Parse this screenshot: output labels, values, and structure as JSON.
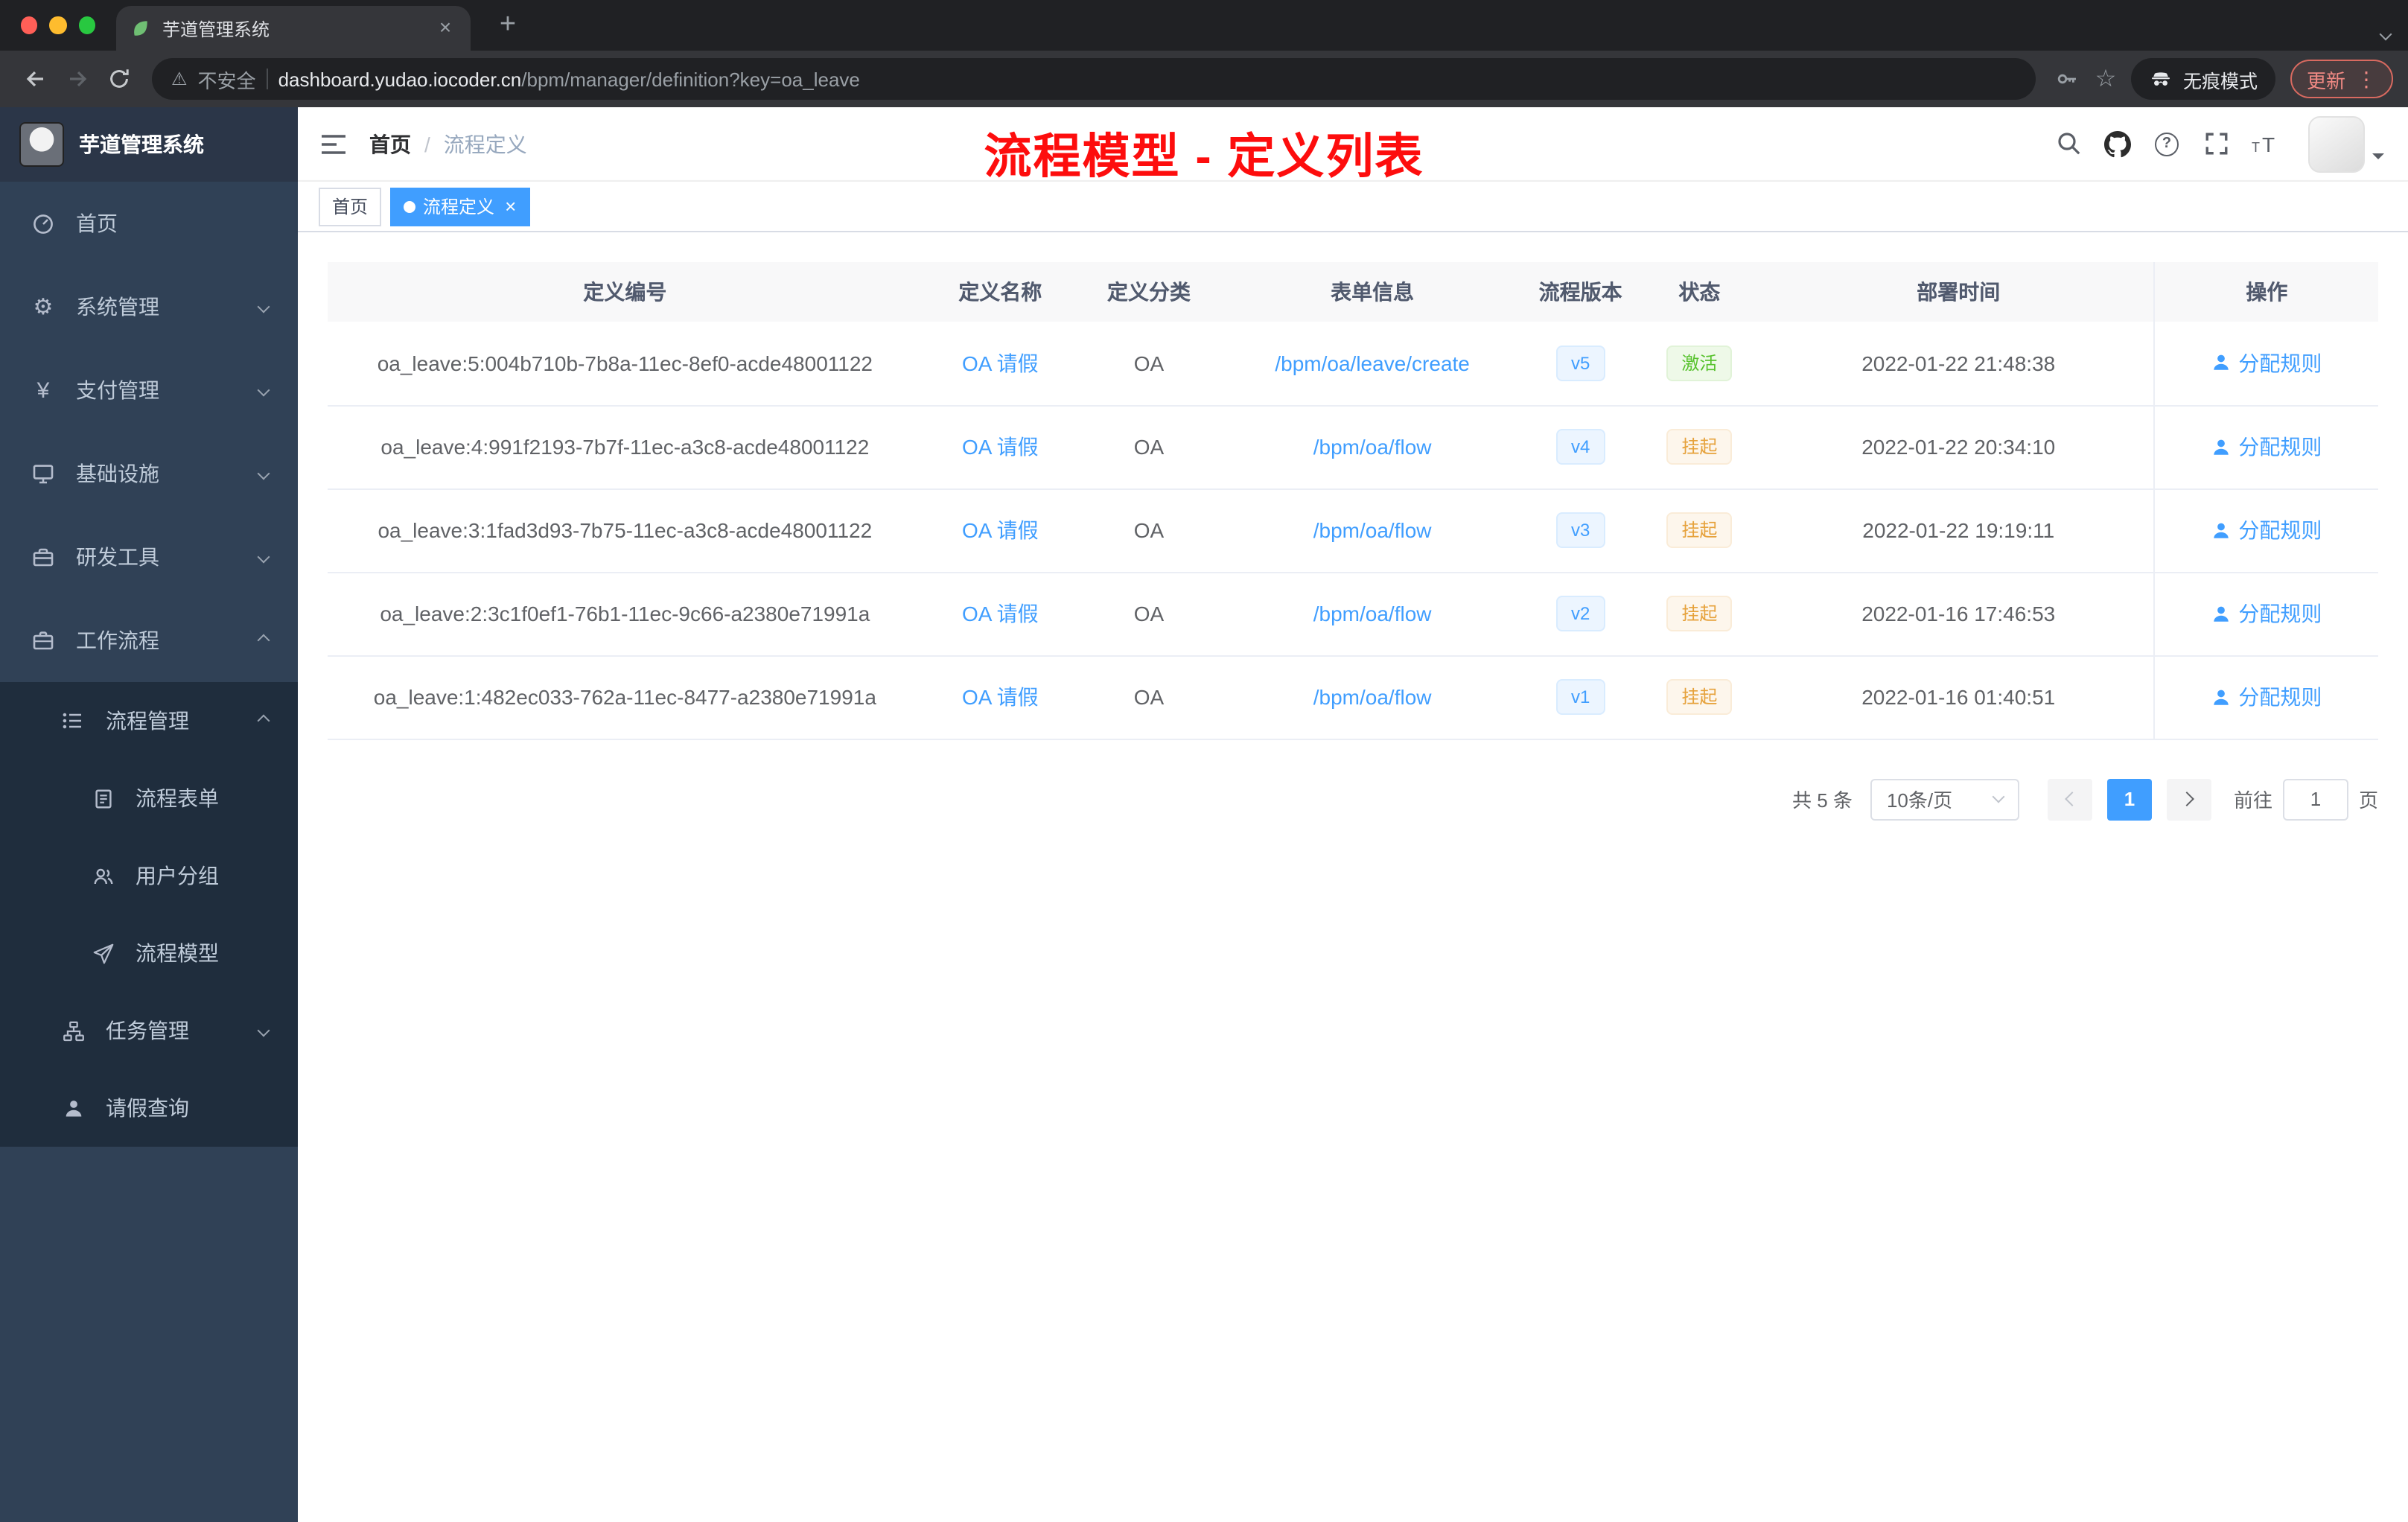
{
  "browser": {
    "tab": {
      "title": "芋道管理系统"
    },
    "toolbar": {
      "security_label": "不安全",
      "url_host": "dashboard.yudao.iocoder.cn",
      "url_path": "/bpm/manager/definition?key=oa_leave",
      "incognito_label": "无痕模式",
      "update_label": "更新"
    }
  },
  "glyphs": {
    "close": "×",
    "plus": "+",
    "star": "☆",
    "warning": "⚠",
    "dots_vertical": "⋮",
    "slash": "/",
    "gear": "⚙",
    "yen": "¥",
    "question": "?"
  },
  "sidebar": {
    "logo_title": "芋道管理系统",
    "items": [
      {
        "label": "首页"
      },
      {
        "label": "系统管理"
      },
      {
        "label": "支付管理"
      },
      {
        "label": "基础设施"
      },
      {
        "label": "研发工具"
      },
      {
        "label": "工作流程"
      }
    ],
    "sub": {
      "process_mgmt": "流程管理",
      "children": [
        {
          "label": "流程表单"
        },
        {
          "label": "用户分组"
        },
        {
          "label": "流程模型"
        }
      ],
      "task_mgmt": "任务管理",
      "leave_query": "请假查询"
    }
  },
  "navbar": {
    "breadcrumb_home": "首页",
    "breadcrumb_current": "流程定义"
  },
  "annotation": "流程模型 - 定义列表",
  "tags": {
    "home": "首页",
    "active": "流程定义"
  },
  "table": {
    "columns": [
      "定义编号",
      "定义名称",
      "定义分类",
      "表单信息",
      "流程版本",
      "状态",
      "部署时间",
      "操作"
    ],
    "rows": [
      {
        "id": "oa_leave:5:004b710b-7b8a-11ec-8ef0-acde48001122",
        "name": "OA 请假",
        "category": "OA",
        "form": "/bpm/oa/leave/create",
        "version": "v5",
        "status": "激活",
        "time": "2022-01-22 21:48:38",
        "action": "分配规则"
      },
      {
        "id": "oa_leave:4:991f2193-7b7f-11ec-a3c8-acde48001122",
        "name": "OA 请假",
        "category": "OA",
        "form": "/bpm/oa/flow",
        "version": "v4",
        "status": "挂起",
        "time": "2022-01-22 20:34:10",
        "action": "分配规则"
      },
      {
        "id": "oa_leave:3:1fad3d93-7b75-11ec-a3c8-acde48001122",
        "name": "OA 请假",
        "category": "OA",
        "form": "/bpm/oa/flow",
        "version": "v3",
        "status": "挂起",
        "time": "2022-01-22 19:19:11",
        "action": "分配规则"
      },
      {
        "id": "oa_leave:2:3c1f0ef1-76b1-11ec-9c66-a2380e71991a",
        "name": "OA 请假",
        "category": "OA",
        "form": "/bpm/oa/flow",
        "version": "v2",
        "status": "挂起",
        "time": "2022-01-16 17:46:53",
        "action": "分配规则"
      },
      {
        "id": "oa_leave:1:482ec033-762a-11ec-8477-a2380e71991a",
        "name": "OA 请假",
        "category": "OA",
        "form": "/bpm/oa/flow",
        "version": "v1",
        "status": "挂起",
        "time": "2022-01-16 01:40:51",
        "action": "分配规则"
      }
    ]
  },
  "pagination": {
    "total": "共 5 条",
    "page_size": "10条/页",
    "page": "1",
    "goto_label": "前往",
    "goto_value": "1",
    "goto_unit": "页"
  },
  "colors": {
    "accent": "#409eff",
    "success": "#67c23a",
    "warning": "#e6a23c",
    "annotation_red": "#fd0d0d",
    "sidebar_bg": "#304156",
    "submenu_bg": "#1f2d3d"
  }
}
